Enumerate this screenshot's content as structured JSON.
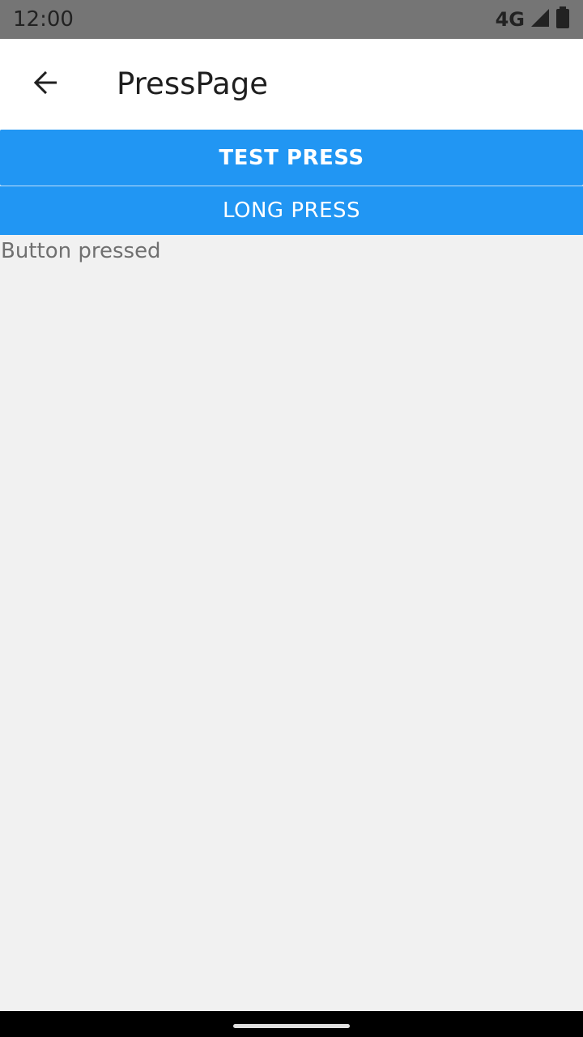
{
  "status_bar": {
    "time": "12:00",
    "network": "4G",
    "icons": [
      "signal-icon",
      "battery-icon"
    ]
  },
  "app_bar": {
    "back_icon": "arrow-left-icon",
    "title": "PressPage"
  },
  "buttons": {
    "test_press": "TEST PRESS",
    "long_press": "LONG PRESS"
  },
  "result": {
    "text": "Button pressed"
  },
  "colors": {
    "accent": "#2196f3",
    "status_bar": "#757575",
    "background": "#f1f1f1"
  }
}
